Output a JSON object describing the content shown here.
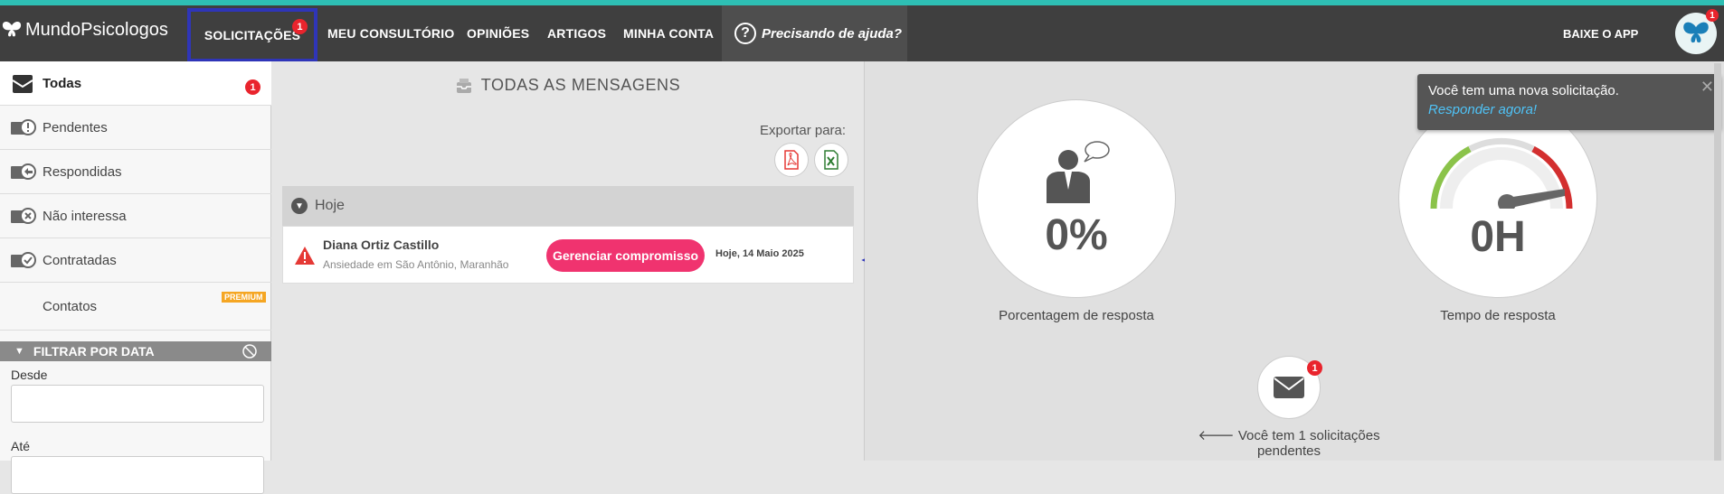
{
  "brand": {
    "name": "MundoPsicologos"
  },
  "nav": {
    "items": [
      "SOLICITAÇÕES",
      "MEU CONSULTÓRIO",
      "OPINIÕES",
      "ARTIGOS",
      "MINHA CONTA"
    ],
    "solicitacoes_badge": "1",
    "help_label": "Precisando de ajuda?",
    "help_icon_glyph": "?",
    "app_label": "BAIXE O APP",
    "avatar_badge": "1"
  },
  "sidebar": {
    "items": [
      {
        "label": "Todas",
        "badge": "1",
        "icon": "envelope-open-icon"
      },
      {
        "label": "Pendentes",
        "icon": "envelope-alert-icon"
      },
      {
        "label": "Respondidas",
        "icon": "envelope-reply-icon"
      },
      {
        "label": "Não interessa",
        "icon": "envelope-x-icon"
      },
      {
        "label": "Contratadas",
        "icon": "envelope-check-icon"
      },
      {
        "label": "Contatos",
        "tag": "PREMIUM"
      }
    ],
    "filter": {
      "title": "FILTRAR POR DATA",
      "from_label": "Desde",
      "to_label": "Até"
    }
  },
  "main": {
    "title": "TODAS AS MENSAGENS",
    "export_label": "Exportar para:",
    "group_label": "Hoje",
    "messages": [
      {
        "name": "Diana Ortiz Castillo",
        "subtitle": "Ansiedade em São Antônio, Maranhão",
        "action": "Gerenciar compromisso",
        "date": "Hoje, 14 Maio 2025"
      }
    ]
  },
  "stats": {
    "response_rate": {
      "value": "0%",
      "label": "Porcentagem de resposta"
    },
    "response_time": {
      "value": "0H",
      "label": "Tempo de resposta"
    },
    "mail_badge": "1",
    "pending_text": "Você tem 1 solicitações pendentes"
  },
  "toast": {
    "message": "Você tem uma nova solicitação.",
    "link": "Responder agora!",
    "close_glyph": "✕"
  },
  "colors": {
    "topbar": "#3f3f3f",
    "accent_teal": "#2ebfb4",
    "button_pink": "#f0336f",
    "badge_red": "#e9242d",
    "highlight_box": "#2f35b8"
  }
}
